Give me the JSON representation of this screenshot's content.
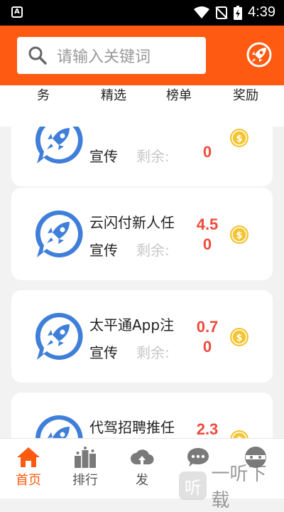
{
  "status_bar": {
    "time": "4:39"
  },
  "header": {
    "search_placeholder": "请输入关键词"
  },
  "tabs": [
    {
      "label": "务"
    },
    {
      "label": "精选"
    },
    {
      "label": "榜单"
    },
    {
      "label": "奖励"
    }
  ],
  "tasks": [
    {
      "title": "",
      "tag": "宣传",
      "remaining": "剩余:",
      "price": "0"
    },
    {
      "title": "云闪付新人任",
      "tag": "宣传",
      "remaining": "剩余:",
      "price": "4.50"
    },
    {
      "title": "太平通App注",
      "tag": "宣传",
      "remaining": "剩余:",
      "price": "0.70"
    },
    {
      "title": "代驾招聘推任",
      "tag": "",
      "remaining": "",
      "price": "2.3"
    }
  ],
  "bottom_nav": [
    {
      "label": "首页",
      "icon": "home-icon"
    },
    {
      "label": "排行",
      "icon": "ranking-icon"
    },
    {
      "label": "发",
      "icon": "publish-icon"
    },
    {
      "label": "",
      "icon": "message-icon"
    },
    {
      "label": "",
      "icon": "profile-icon"
    }
  ],
  "watermark": {
    "text": "一听下载",
    "icon_char": "听"
  },
  "colors": {
    "accent": "#ff5a12",
    "price": "#ee4a3c",
    "logo_blue": "#3f7fd9",
    "coin": "#f4c431"
  }
}
